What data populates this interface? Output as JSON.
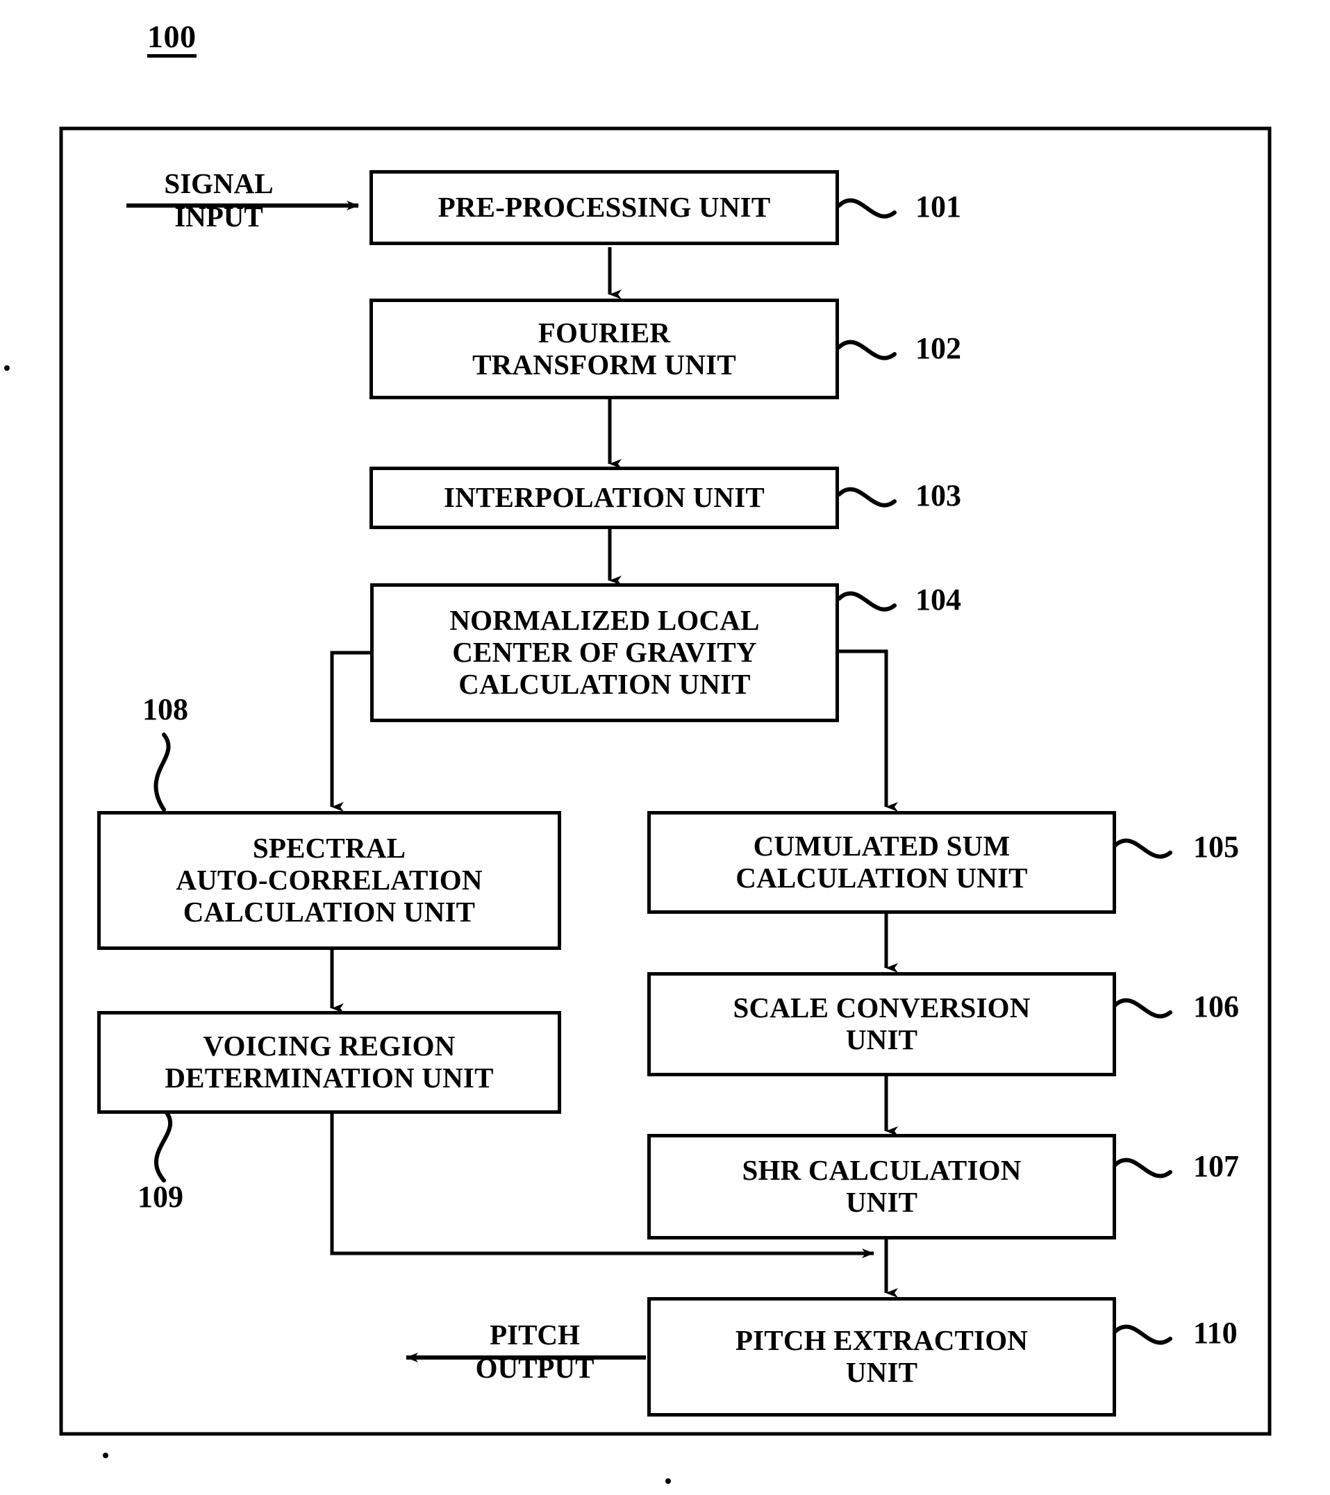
{
  "figure": {
    "number": "100"
  },
  "io_labels": {
    "signal_input": "SIGNAL\nINPUT",
    "pitch_output": "PITCH\nOUTPUT"
  },
  "blocks": [
    {
      "id": "101",
      "label": "PRE-PROCESSING UNIT",
      "ref": "101"
    },
    {
      "id": "102",
      "label": "FOURIER\nTRANSFORM UNIT",
      "ref": "102"
    },
    {
      "id": "103",
      "label": "INTERPOLATION UNIT",
      "ref": "103"
    },
    {
      "id": "104",
      "label": "NORMALIZED LOCAL\nCENTER OF GRAVITY\nCALCULATION UNIT",
      "ref": "104"
    },
    {
      "id": "105",
      "label": "CUMULATED SUM\nCALCULATION UNIT",
      "ref": "105"
    },
    {
      "id": "106",
      "label": "SCALE CONVERSION\nUNIT",
      "ref": "106"
    },
    {
      "id": "107",
      "label": "SHR CALCULATION\nUNIT",
      "ref": "107"
    },
    {
      "id": "108",
      "label": "SPECTRAL\nAUTO-CORRELATION\nCALCULATION UNIT",
      "ref": "108"
    },
    {
      "id": "109",
      "label": "VOICING REGION\nDETERMINATION UNIT",
      "ref": "109"
    },
    {
      "id": "110",
      "label": "PITCH EXTRACTION\nUNIT",
      "ref": "110"
    }
  ],
  "colors": {
    "line": "#000000",
    "background": "#ffffff"
  }
}
